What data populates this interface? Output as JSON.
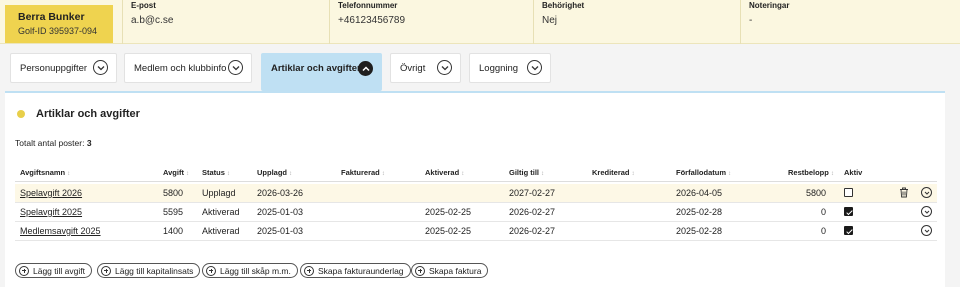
{
  "member": {
    "name": "Berra Bunker",
    "golf_id": "Golf-ID 395937-094"
  },
  "info_fields": [
    {
      "label": "E-post",
      "value": "a.b@c.se"
    },
    {
      "label": "Telefonnummer",
      "value": "+46123456789"
    },
    {
      "label": "Behörighet",
      "value": "Nej"
    },
    {
      "label": "Noteringar",
      "value": "-"
    }
  ],
  "tabs": [
    {
      "label": "Personuppgifter",
      "active": false
    },
    {
      "label": "Medlem och klubbinfo",
      "active": false
    },
    {
      "label": "Artiklar och avgifter",
      "active": true
    },
    {
      "label": "Övrigt",
      "active": false
    },
    {
      "label": "Loggning",
      "active": false
    }
  ],
  "section": {
    "title": "Artiklar och avgifter",
    "total_label": "Totalt antal poster:",
    "total_count": "3"
  },
  "table": {
    "columns": [
      "Avgiftsnamn",
      "Avgift",
      "Status",
      "Upplagd",
      "Fakturerad",
      "Aktiverad",
      "Giltig till",
      "Krediterad",
      "Förfallodatum",
      "Restbelopp",
      "Aktiv"
    ],
    "rows": [
      {
        "name": "Spelavgift 2026",
        "fee": "5800",
        "status": "Upplagd",
        "created": "2026-03-26",
        "invoiced": "",
        "activated": "",
        "valid_until": "2027-02-27",
        "credited": "",
        "due_date": "2026-04-05",
        "remaining": "5800",
        "active": false,
        "deletable": true
      },
      {
        "name": "Spelavgift 2025",
        "fee": "5595",
        "status": "Aktiverad",
        "created": "2025-01-03",
        "invoiced": "",
        "activated": "2025-02-25",
        "valid_until": "2026-02-27",
        "credited": "",
        "due_date": "2025-02-28",
        "remaining": "0",
        "active": true,
        "deletable": false
      },
      {
        "name": "Medlemsavgift 2025",
        "fee": "1400",
        "status": "Aktiverad",
        "created": "2025-01-03",
        "invoiced": "",
        "activated": "2025-02-25",
        "valid_until": "2026-02-27",
        "credited": "",
        "due_date": "2025-02-28",
        "remaining": "0",
        "active": true,
        "deletable": false
      }
    ]
  },
  "actions": [
    {
      "label": "Lägg till avgift"
    },
    {
      "label": "Lägg till kapitalinsats"
    },
    {
      "label": "Lägg till skåp m.m."
    },
    {
      "label": "Skapa fakturaunderlag"
    },
    {
      "label": "Skapa faktura"
    }
  ],
  "icons": {
    "tab_toggle": "chevron-down-icon",
    "active_tab_toggle": "chevron-up-icon",
    "row_expand": "chevron-down-icon",
    "delete": "trash-icon",
    "add": "plus-circle-icon"
  },
  "colors": {
    "member_card": "#efd34f",
    "member_strip": "#fbf7e0",
    "active_tab": "#bfe0f3",
    "section_dot": "#e8cf4a",
    "highlight_row": "#fdf8e6"
  }
}
